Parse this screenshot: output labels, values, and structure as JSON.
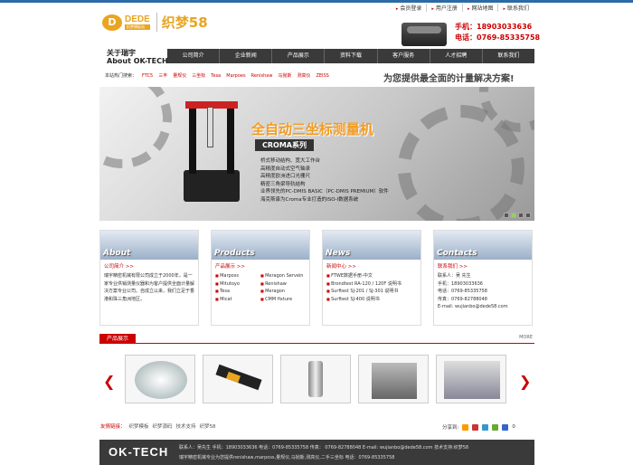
{
  "top_links": [
    "会员登录",
    "用户注册",
    "网站地图",
    "联系我们"
  ],
  "logo": {
    "mark": "D",
    "en": "DEDE",
    "sub": "织梦模板站",
    "cn": "织梦58"
  },
  "top_contact": {
    "mobile": "手机：18903033636",
    "phone": "电话：0769-85335758"
  },
  "about_heading": {
    "cn": "关于瑞宇",
    "en": "About OK-TECH"
  },
  "nav": [
    "公司简介",
    "企业新闻",
    "产品展示",
    "资料下载",
    "客户服务",
    "人才招聘",
    "联系我们"
  ],
  "hot": {
    "label": "本站热门搜索：",
    "items": [
      "FTC5",
      "三丰",
      "量规仪",
      "三坐标",
      "Tesa",
      "Marpoes",
      "Renishaw",
      "马抛斯",
      "测高仪",
      "ZEISS"
    ]
  },
  "slogan": "为您提供最全面的计量解决方案!",
  "banner": {
    "title": "全自动三坐标测量机",
    "series": "CROMA系列",
    "lines": [
      "桥式移动结构、宽大工作台",
      "高精度自动式空气轴承",
      "高精度欧洲进口光栅尺",
      "精密三角梁导轨结构",
      "业界领先的PC-DMIS BASIC（PC-DMIS PREMIUM）软件",
      "海克斯康为Croma专业打造的ISO-I数据系统"
    ]
  },
  "boxes": [
    {
      "title": "About",
      "sub": "公司简介 >>",
      "body": "瑞宇精密机械有限公司成立于2000年，是一家专业供销测量仪器和为客户提供全面计量解决方案专业公司。自成立以来，我们立足于香港和珠三角洲地区。"
    },
    {
      "title": "Products",
      "sub": "产品展示 >>",
      "items": [
        "Marposs",
        "Meragon Servein",
        "Mitutoyo",
        "Renishaw",
        "Tesa",
        "Meragon",
        "Micat",
        "CMM fixture"
      ]
    },
    {
      "title": "News",
      "sub": "新闻中心 >>",
      "items": [
        "FTWE数据手册-中文",
        "Brondtest RA-120 / 120F 说明书",
        "Surftest SJ-201 / SJ-301 说明书",
        "Surftest SJ-400 说明书"
      ]
    },
    {
      "title": "Contacts",
      "sub": "联系我们 >>",
      "items": [
        "联系人：吴 先生",
        "手机：18903033636",
        "电话：0769-85335758",
        "传真：0769-82788048",
        "E-mail: wujianbo@dede58.com"
      ]
    }
  ],
  "products": {
    "label": "产品展示",
    "more": "MORE"
  },
  "links": {
    "label": "友情链接：",
    "items": [
      "织梦模板",
      "织梦源码",
      "技术支持",
      "织梦58"
    ]
  },
  "share": {
    "label": "分享到:",
    "count": "0"
  },
  "footer": {
    "logo": "OK-TECH",
    "line1": "联系人：吴先生 手机：18903033636  电话：0769-85335758 传真： 0769-82788048 E-mail: wujianbo@dede58.com 技术支持:织梦58",
    "line2": "瑞宇精密机械专业为您提供renishaw,marposs,量规仪,马抛斯,测高仪,二手三坐标 电话：0769-85335758"
  },
  "colors": {
    "accent": "#cc0000",
    "logo_orange": "#e8a521",
    "nav_bg": "#3a3a3a"
  }
}
